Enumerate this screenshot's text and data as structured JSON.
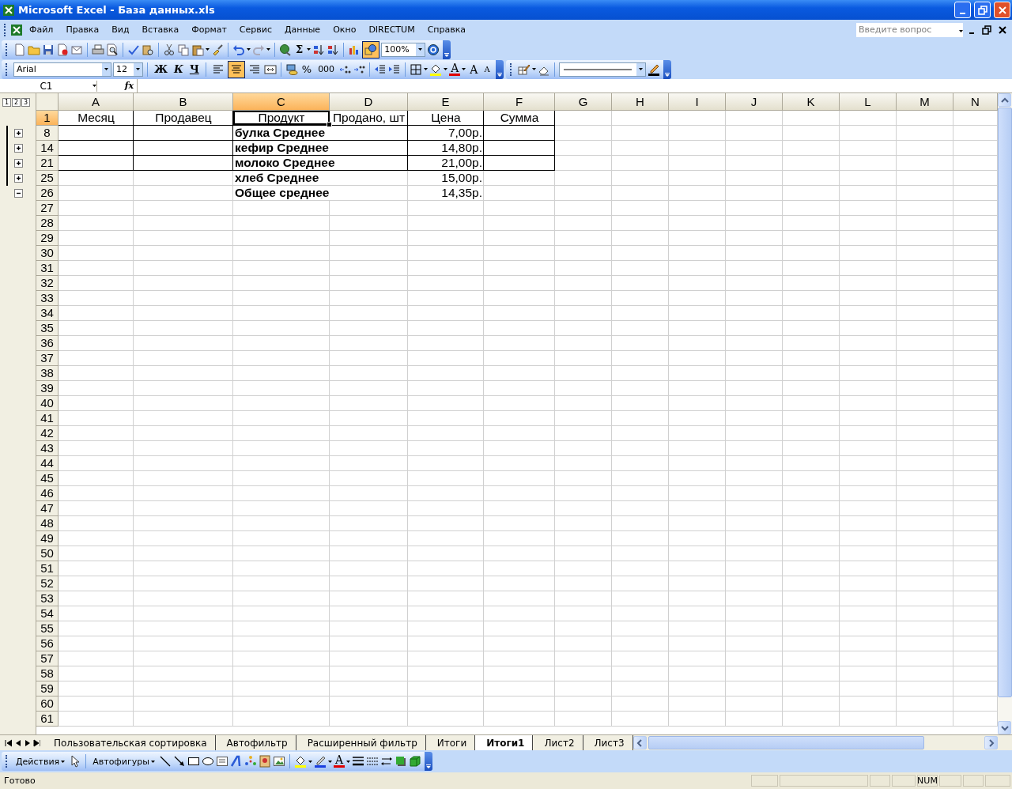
{
  "window": {
    "title": "Microsoft Excel - База данных.xls"
  },
  "menu": {
    "items": [
      "Файл",
      "Правка",
      "Вид",
      "Вставка",
      "Формат",
      "Сервис",
      "Данные",
      "Окно",
      "DIRECTUM",
      "Справка"
    ],
    "help_placeholder": "Введите вопрос"
  },
  "standard_toolbar": {
    "autosum": "Σ",
    "zoom": "100%",
    "drawing_selected": true
  },
  "format_toolbar": {
    "font": "Arial",
    "size": "12",
    "bold": "Ж",
    "italic": "К",
    "underline": "Ч",
    "alignment": [
      {
        "selected": false
      },
      {
        "selected": true
      },
      {
        "selected": false
      }
    ],
    "percent": "%",
    "thousands": "000",
    "font_color": "A",
    "grow_font": "A",
    "shrink_font": "A"
  },
  "formula_bar": {
    "name_box": "C1",
    "fx": "fx"
  },
  "sheet": {
    "outline_levels": [
      "1",
      "2",
      "3"
    ],
    "columns": [
      {
        "label": "A",
        "selected": false
      },
      {
        "label": "B",
        "selected": false
      },
      {
        "label": "C",
        "selected": true
      },
      {
        "label": "D",
        "selected": false
      },
      {
        "label": "E",
        "selected": false
      },
      {
        "label": "F",
        "selected": false
      },
      {
        "label": "G",
        "selected": false
      },
      {
        "label": "H",
        "selected": false
      },
      {
        "label": "I",
        "selected": false
      },
      {
        "label": "J",
        "selected": false
      },
      {
        "label": "K",
        "selected": false
      },
      {
        "label": "L",
        "selected": false
      },
      {
        "label": "M",
        "selected": false
      },
      {
        "label": "N",
        "selected": false
      }
    ],
    "rows": [
      {
        "label": "1",
        "selected": true,
        "bordered": true,
        "cells": [
          {
            "kind": "header",
            "text": "Месяц",
            "selected": false
          },
          {
            "kind": "header",
            "text": "Продавец",
            "selected": false
          },
          {
            "kind": "header",
            "text": "Продукт",
            "selected": true
          },
          {
            "kind": "header",
            "text": "Продано, шт",
            "selected": false
          },
          {
            "kind": "header",
            "text": "Цена",
            "selected": false
          },
          {
            "kind": "header",
            "text": "Сумма",
            "selected": false
          }
        ]
      },
      {
        "label": "8",
        "selected": false,
        "bordered": true,
        "outline": {
          "expanded": false
        },
        "cells": [
          null,
          null,
          {
            "kind": "label",
            "text": "булка Среднее",
            "selected": false
          },
          null,
          {
            "kind": "currency",
            "text": "7,00р.",
            "selected": false
          },
          null
        ]
      },
      {
        "label": "14",
        "selected": false,
        "bordered": true,
        "outline": {
          "expanded": false
        },
        "cells": [
          null,
          null,
          {
            "kind": "label",
            "text": "кефир Среднее",
            "selected": false
          },
          null,
          {
            "kind": "currency",
            "text": "14,80р.",
            "selected": false
          },
          null
        ]
      },
      {
        "label": "21",
        "selected": false,
        "bordered": true,
        "outline": {
          "expanded": false
        },
        "cells": [
          null,
          null,
          {
            "kind": "label",
            "text": "молоко Среднее",
            "selected": false
          },
          null,
          {
            "kind": "currency",
            "text": "21,00р.",
            "selected": false
          },
          null
        ]
      },
      {
        "label": "25",
        "selected": false,
        "bordered": false,
        "outline": {
          "expanded": false
        },
        "cells": [
          null,
          null,
          {
            "kind": "label",
            "text": "хлеб Среднее",
            "selected": false
          },
          null,
          {
            "kind": "currency",
            "text": "15,00р.",
            "selected": false
          },
          null
        ]
      },
      {
        "label": "26",
        "selected": false,
        "bordered": false,
        "outline": {
          "expanded": true
        },
        "cells": [
          null,
          null,
          {
            "kind": "label",
            "text": "Общее среднее",
            "selected": false
          },
          null,
          {
            "kind": "currency",
            "text": "14,35р.",
            "selected": false
          },
          null
        ]
      },
      {
        "label": "27",
        "selected": false
      },
      {
        "label": "28",
        "selected": false
      },
      {
        "label": "29",
        "selected": false
      },
      {
        "label": "30",
        "selected": false
      },
      {
        "label": "31",
        "selected": false
      },
      {
        "label": "32",
        "selected": false
      },
      {
        "label": "33",
        "selected": false
      },
      {
        "label": "34",
        "selected": false
      },
      {
        "label": "35",
        "selected": false
      },
      {
        "label": "36",
        "selected": false
      },
      {
        "label": "37",
        "selected": false
      },
      {
        "label": "38",
        "selected": false
      },
      {
        "label": "39",
        "selected": false
      },
      {
        "label": "40",
        "selected": false
      },
      {
        "label": "41",
        "selected": false
      },
      {
        "label": "42",
        "selected": false
      },
      {
        "label": "43",
        "selected": false
      },
      {
        "label": "44",
        "selected": false
      },
      {
        "label": "45",
        "selected": false
      },
      {
        "label": "46",
        "selected": false
      },
      {
        "label": "47",
        "selected": false
      },
      {
        "label": "48",
        "selected": false
      },
      {
        "label": "49",
        "selected": false
      },
      {
        "label": "50",
        "selected": false
      },
      {
        "label": "51",
        "selected": false
      },
      {
        "label": "52",
        "selected": false
      },
      {
        "label": "53",
        "selected": false
      },
      {
        "label": "54",
        "selected": false
      },
      {
        "label": "55",
        "selected": false
      },
      {
        "label": "56",
        "selected": false
      },
      {
        "label": "57",
        "selected": false
      },
      {
        "label": "58",
        "selected": false
      },
      {
        "label": "59",
        "selected": false
      },
      {
        "label": "60",
        "selected": false
      },
      {
        "label": "61",
        "selected": false
      }
    ]
  },
  "sheet_tabs": [
    {
      "label": "Пользовательская сортировка",
      "selected": false
    },
    {
      "label": "Автофильтр",
      "selected": false
    },
    {
      "label": "Расширенный фильтр",
      "selected": false
    },
    {
      "label": "Итоги",
      "selected": false
    },
    {
      "label": "Итоги1",
      "selected": true
    },
    {
      "label": "Лист2",
      "selected": false
    },
    {
      "label": "Лист3",
      "selected": false
    }
  ],
  "drawing_toolbar": {
    "actions": "Действия",
    "autoshapes": "Автофигуры",
    "font_color": "A"
  },
  "status_bar": {
    "text": "Готово",
    "indicators": [
      "NUM"
    ]
  }
}
